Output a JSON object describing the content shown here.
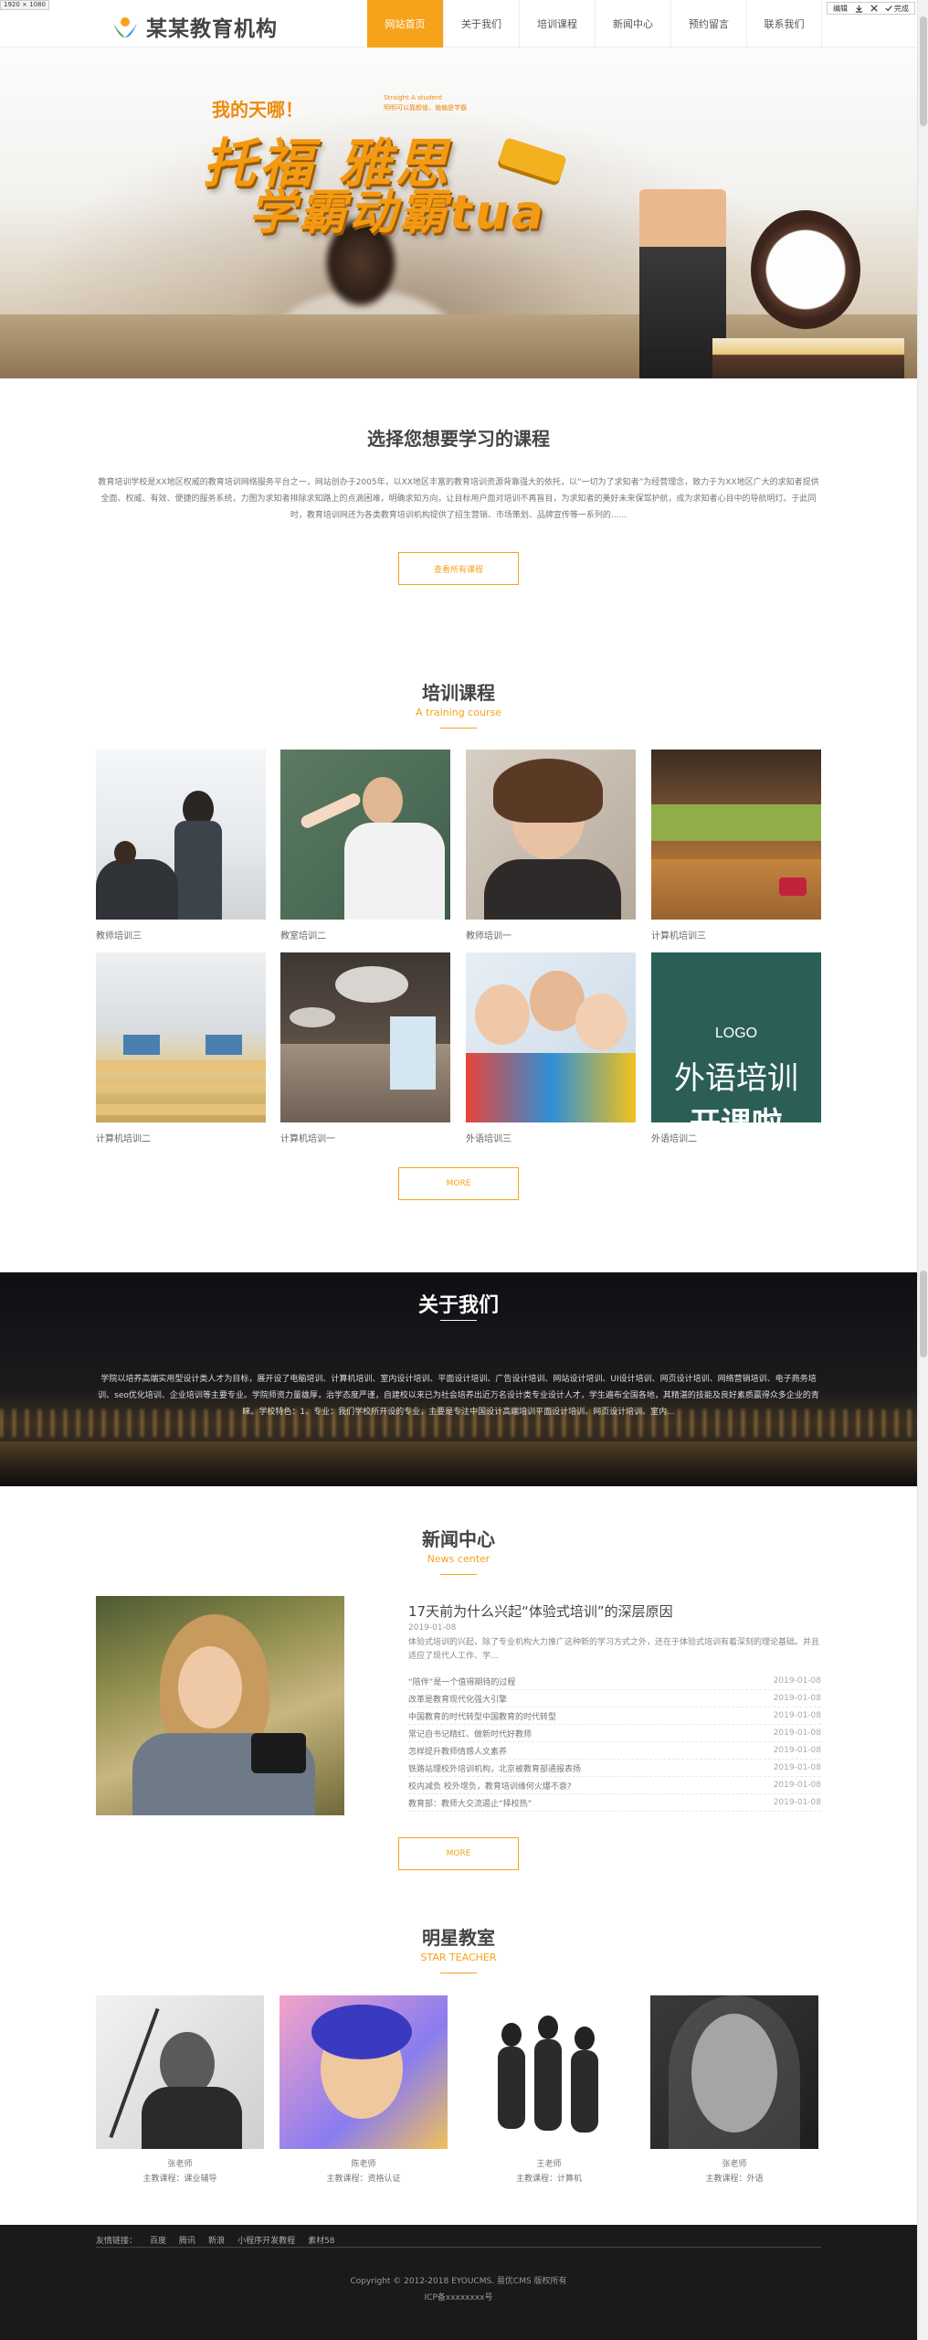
{
  "screenshot_tag": "1920 × 1080",
  "edit_toolbar": {
    "items": [
      "编辑",
      "下载",
      "关闭",
      "完成"
    ]
  },
  "header": {
    "logo_text": "某某教育机构",
    "nav": [
      "网站首页",
      "关于我们",
      "培训课程",
      "新闻中心",
      "预约留言",
      "联系我们"
    ],
    "active_index": 0
  },
  "banner": {
    "tag1": "我的天哪！",
    "tag2_line1": "Straight A student",
    "tag2_line2": "明明可以靠颜值，偏偏是学霸",
    "title1": "托福 雅思",
    "title2": "学霸动霸tua"
  },
  "intro": {
    "title": "选择您想要学习的课程",
    "text": "教育培训学校是XX地区权威的教育培训网络服务平台之一，网站创办于2005年，以XX地区丰富的教育培训资源背靠强大的依托，以“一切为了求知者”为经营理念，致力于为XX地区广大的求知者提供全面、权威、有效、便捷的服务系统，力图为求知者排除求知路上的点滴困难，明确求知方向，让目标用户面对培训不再盲目，为求知者的美好未来保驾护航，成为求知者心目中的导航明灯。于此同时，教育培训网还为各类教育培训机构提供了招生营销、市场策划、品牌宣传等一系列的......",
    "button": "查看所有课程"
  },
  "training": {
    "title": "培训课程",
    "subtitle": "A training course",
    "courses": [
      {
        "name": "教师培训三"
      },
      {
        "name": "教室培训二"
      },
      {
        "name": "教师培训一"
      },
      {
        "name": "计算机培训三"
      },
      {
        "name": "计算机培训二"
      },
      {
        "name": "计算机培训一"
      },
      {
        "name": "外语培训三"
      },
      {
        "name": "外语培训二"
      }
    ],
    "poster": {
      "logo": "LOGO",
      "line1": "外语培训",
      "line2": "开课啦"
    },
    "more": "MORE"
  },
  "about": {
    "title": "关于我们",
    "text": "学院以培养高端实用型设计类人才为目标，展开设了电脑培训、计算机培训、室内设计培训、平面设计培训、广告设计培训、网站设计培训、UI设计培训、网页设计培训、网络营销培训、电子商务培训、seo优化培训、企业培训等主要专业。学院师资力量雄厚，治学态度严谨，自建校以来已为社会培养出近万名设计类专业设计人才，学生遍布全国各地，其精湛的技能及良好素质赢得众多企业的青睐。学校特色：1、专业：我们学校所开设的专业，主要是专注中国设计高端培训平面设计培训、网页设计培训、室内..."
  },
  "news": {
    "title": "新闻中心",
    "subtitle": "News center",
    "featured": {
      "headline": "17天前为什么兴起“体验式培训”的深层原因",
      "date": "2019-01-08",
      "summary": "体验式培训的兴起，除了专业机构大力推广这种新的学习方式之外，还在于体验式培训有着深刻的理论基础。并且适应了现代人工作、学..."
    },
    "items": [
      {
        "title": "“陪伴”是一个值得期待的过程",
        "date": "2019-01-08"
      },
      {
        "title": "改革是教育现代化强大引擎",
        "date": "2019-01-08"
      },
      {
        "title": "中国教育的时代转型中国教育的时代转型",
        "date": "2019-01-08"
      },
      {
        "title": "常记自书记精红、做新时代好教师",
        "date": "2019-01-08"
      },
      {
        "title": "怎样提升教师情感人文素养",
        "date": "2019-01-08"
      },
      {
        "title": "铁路站理校外培训机构，北京被教育部通报表扬",
        "date": "2019-01-08"
      },
      {
        "title": "校内减负 校外增负，教育培训缘何火爆不衰?",
        "date": "2019-01-08"
      },
      {
        "title": "教育部：教师大交流遏止“择校热”",
        "date": "2019-01-08"
      }
    ],
    "more": "MORE"
  },
  "teachers": {
    "title": "明星教室",
    "subtitle": "STAR TEACHER",
    "list": [
      {
        "name": "张老师",
        "major": "主教课程：课业辅导"
      },
      {
        "name": "陈老师",
        "major": "主教课程：资格认证"
      },
      {
        "name": "王老师",
        "major": "主教课程：计算机"
      },
      {
        "name": "张老师",
        "major": "主教课程：外语"
      }
    ]
  },
  "footer": {
    "friend_label": "友情链接：",
    "links": [
      "百度",
      "腾讯",
      "新浪",
      "小程序开发教程",
      "素材58"
    ],
    "copyright": "Copyright © 2012-2018 EYOUCMS. 易优CMS 版权所有",
    "icp": "ICP备xxxxxxxx号"
  },
  "colors": {
    "accent": "#f7a21b",
    "footer_bg": "#1a1a1a"
  }
}
